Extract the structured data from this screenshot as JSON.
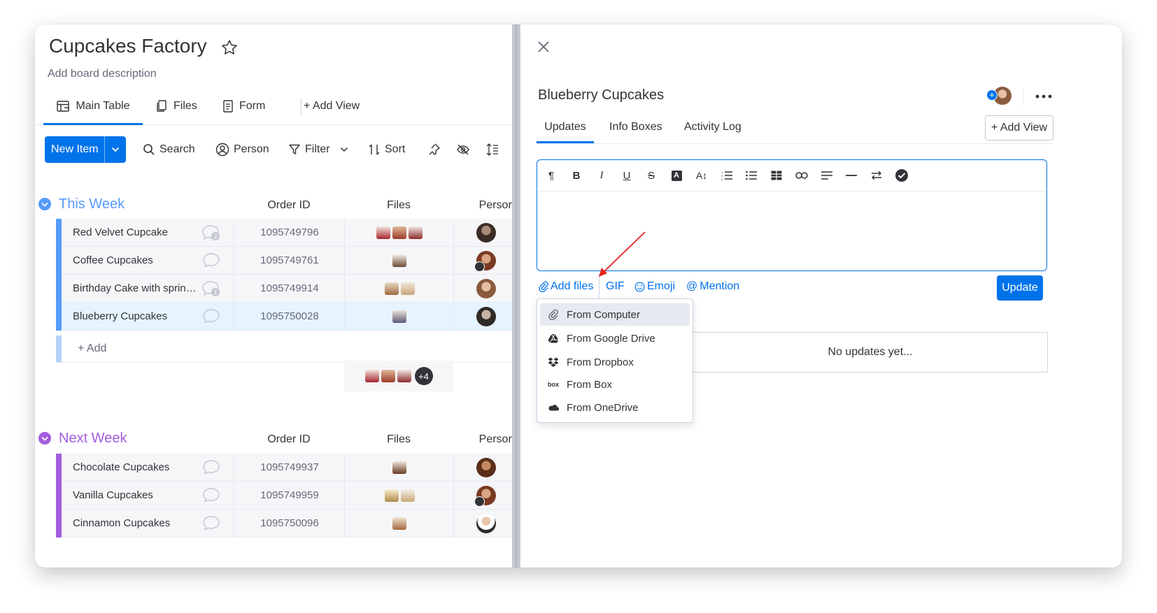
{
  "board": {
    "title": "Cupcakes Factory",
    "description": "Add board description"
  },
  "views": {
    "main_table": "Main Table",
    "files": "Files",
    "form": "Form",
    "add_view": "+ Add View"
  },
  "toolbar": {
    "new_item": "New Item",
    "search": "Search",
    "person": "Person",
    "filter": "Filter",
    "sort": "Sort"
  },
  "colors": {
    "accent": "#0073ea",
    "this_week": "#579bfc",
    "next_week": "#a25ddc"
  },
  "groups": [
    {
      "title": "This Week",
      "col_order_id": "Order ID",
      "col_files": "Files",
      "col_person": "Person",
      "rows": [
        {
          "name": "Red Velvet Cupcake",
          "order_id": "1095749796",
          "updates": "2"
        },
        {
          "name": "Coffee Cupcakes",
          "order_id": "1095749761",
          "updates": ""
        },
        {
          "name": "Birthday Cake with sprinkl...",
          "order_id": "1095749914",
          "updates": "1"
        },
        {
          "name": "Blueberry Cupcakes",
          "order_id": "1095750028",
          "updates": ""
        }
      ],
      "add_label": "+ Add",
      "files_more": "+4"
    },
    {
      "title": "Next Week",
      "col_order_id": "Order ID",
      "col_files": "Files",
      "col_person": "Person",
      "rows": [
        {
          "name": "Chocolate Cupcakes",
          "order_id": "1095749937"
        },
        {
          "name": "Vanilla Cupcakes",
          "order_id": "1095749959"
        },
        {
          "name": "Cinnamon Cupcakes",
          "order_id": "1095750096"
        }
      ]
    }
  ],
  "item_panel": {
    "title": "Blueberry Cupcakes",
    "tabs": [
      "Updates",
      "Info Boxes",
      "Activity Log"
    ],
    "add_view": "+ Add View",
    "actions": {
      "add_files": "Add files",
      "gif": "GIF",
      "emoji": "Emoji",
      "mention": "Mention"
    },
    "update_button": "Update",
    "empty_text": "No updates yet...",
    "file_menu": [
      {
        "label": "From Computer",
        "icon": "paperclip-icon"
      },
      {
        "label": "From Google Drive",
        "icon": "google-drive-icon"
      },
      {
        "label": "From Dropbox",
        "icon": "dropbox-icon"
      },
      {
        "label": "From Box",
        "icon": "box-icon"
      },
      {
        "label": "From OneDrive",
        "icon": "onedrive-icon"
      }
    ]
  }
}
